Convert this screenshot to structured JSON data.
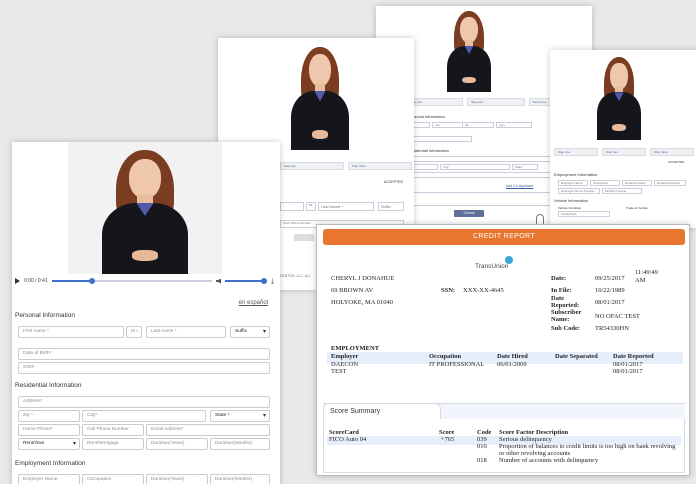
{
  "front_form": {
    "player": {
      "time": "0:00 / 0:41",
      "progress": 0.25,
      "volume": 1.0
    },
    "language_link": "en español",
    "sections": {
      "personal": "Personal Information",
      "residential": "Residential Information",
      "employment": "Employment Information"
    },
    "fields": {
      "first_name": "First name *",
      "mi": "M I",
      "last_name": "Last name *",
      "suffix": "Suffix",
      "dob": "Date of Birth*",
      "ssn": "SSN*",
      "address": "Address*",
      "zip": "Zip *",
      "city": "City*",
      "state": "State *",
      "home_phone": "Home Phone*",
      "cell_phone": "Cell Phone Number",
      "email": "Email Address*",
      "rent_own": "Rent/Own",
      "rent_mortgage": "Rent/Mortgage",
      "duration_years": "Duration(Years)",
      "duration_months": "Duration(Months)",
      "employer": "Employer Name",
      "occupation": "Occupation",
      "emp_years": "Duration(Years)",
      "emp_months": "Duration(Months)"
    }
  },
  "back_sheet_1": {
    "tab_1": "Step two",
    "tab_2": "Step three",
    "accepted": "ACCEPTED",
    "m_field": "MI",
    "last_name": "Last Name *",
    "suffix": "Suffix",
    "work_phone": "Work Phone Number",
    "footer": "DEBTOR, LLC. ALL"
  },
  "back_sheet_2": {
    "tab_1": "Step one",
    "tab_2": "Step two",
    "tab_3": "Step three",
    "section_1": "Personal Information",
    "section_2": "Residential Information",
    "select_1": "mm",
    "select_2": "dd",
    "select_3": "yyyy",
    "zip": "Zip",
    "city": "City*",
    "state": "State *",
    "link": "Add Co-Applicant",
    "button": "Submit"
  },
  "back_sheet_3": {
    "tab_1": "Step one",
    "tab_2": "Step two",
    "tab_3": "Step three",
    "accepted": "ACCEPTED",
    "section_1": "Employment Information",
    "section_2": "Vehicle Information",
    "f1": "Employer Name",
    "f2": "Occupation",
    "f3": "Duration(Years)",
    "f4": "Duration(Months)",
    "f5": "Employer Phone Number",
    "f6": "Monthly Income",
    "f7": "Vehicle Condition",
    "f8": "Trade-In Vehicle",
    "f9": "Stock/Used"
  },
  "credit_report": {
    "title": "CREDIT REPORT",
    "bureau": "TransUnion",
    "name": "CHERYL J DONAHUE",
    "street": "69 BROWN AV",
    "city_state": "HOLYOKE,  MA  01040",
    "ssn_label": "SSN:",
    "ssn": "XXX-XX-4645",
    "labels": {
      "date": "Date:",
      "in_file": "In File:",
      "date_reported": "Date Reported:",
      "subscriber": "Subscriber Name:",
      "sub_code": "Sub Code:"
    },
    "values": {
      "date": "09/25/2017",
      "time": "11:49:49 AM",
      "in_file": "10/22/1989",
      "date_reported": "08/01/2017",
      "subscriber": "NO OFAC TEST",
      "sub_code": "TR54330HN"
    },
    "employment": {
      "heading": "EMPLOYMENT",
      "headers": [
        "Employer",
        "Occupation",
        "Date Hired",
        "Date Separated",
        "Date Reported"
      ],
      "rows": [
        [
          "DAECON",
          "IT PROFESSIONAL",
          "06/01/2009",
          "",
          "08/01/2017"
        ],
        [
          "TEST",
          "",
          "",
          "",
          "08/01/2017"
        ]
      ]
    },
    "score_summary": {
      "tab": "Score Summary",
      "headers": [
        "ScoreCard",
        "Score",
        "Code",
        "Score Factor Description"
      ],
      "scorecard": "FICO Auto 04",
      "score": "+765",
      "factors": [
        {
          "code": "039",
          "desc": "Serious delinquency"
        },
        {
          "code": "010",
          "desc": "Proportion of balances to credit limits is too high on bank revolving"
        },
        {
          "code": "",
          "desc": "or other revolving accounts"
        },
        {
          "code": "018",
          "desc": "Number of accounts with delinquency"
        }
      ]
    }
  },
  "colors": {
    "report_bar": "#e8762f",
    "accent_blue": "#3f6fc9",
    "presenter_jacket": "#15151b",
    "presenter_hair": "#7a3d22"
  }
}
